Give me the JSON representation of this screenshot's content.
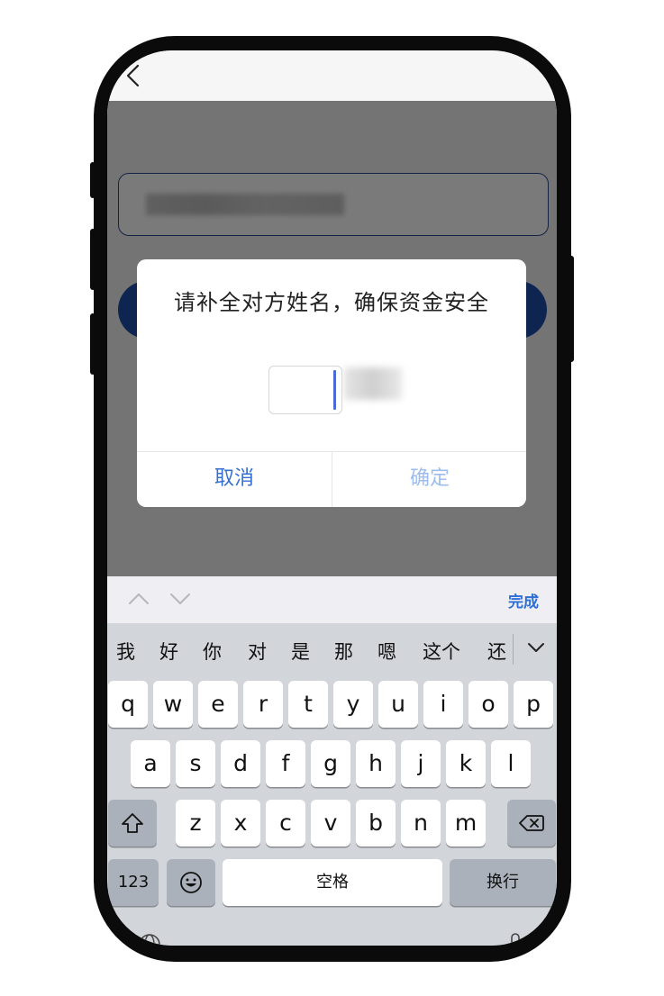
{
  "dialog": {
    "title": "请补全对方姓名，确保资金安全",
    "cancel_label": "取消",
    "confirm_label": "确定",
    "name_input_value": ""
  },
  "keyboard_toolbar": {
    "done_label": "完成"
  },
  "candidates": [
    "我",
    "好",
    "你",
    "对",
    "是",
    "那",
    "嗯",
    "这个",
    "还"
  ],
  "keyboard": {
    "row1": [
      "q",
      "w",
      "e",
      "r",
      "t",
      "y",
      "u",
      "i",
      "o",
      "p"
    ],
    "row2": [
      "a",
      "s",
      "d",
      "f",
      "g",
      "h",
      "j",
      "k",
      "l"
    ],
    "row3": [
      "z",
      "x",
      "c",
      "v",
      "b",
      "n",
      "m"
    ],
    "numbers_label": "123",
    "space_label": "空格",
    "return_label": "换行"
  },
  "icons": {
    "back": "chevron-left-icon",
    "prev_field": "chevron-up-icon",
    "next_field": "chevron-down-icon",
    "expand_candidates": "chevron-down-icon",
    "shift": "shift-icon",
    "delete": "backspace-icon",
    "emoji": "emoji-icon",
    "globe": "globe-icon",
    "mic": "microphone-icon"
  },
  "colors": {
    "accent": "#3470d0",
    "primary_button": "#1d4fa8",
    "disabled_text": "#9dbdf0",
    "caret": "#4a6bd6"
  }
}
